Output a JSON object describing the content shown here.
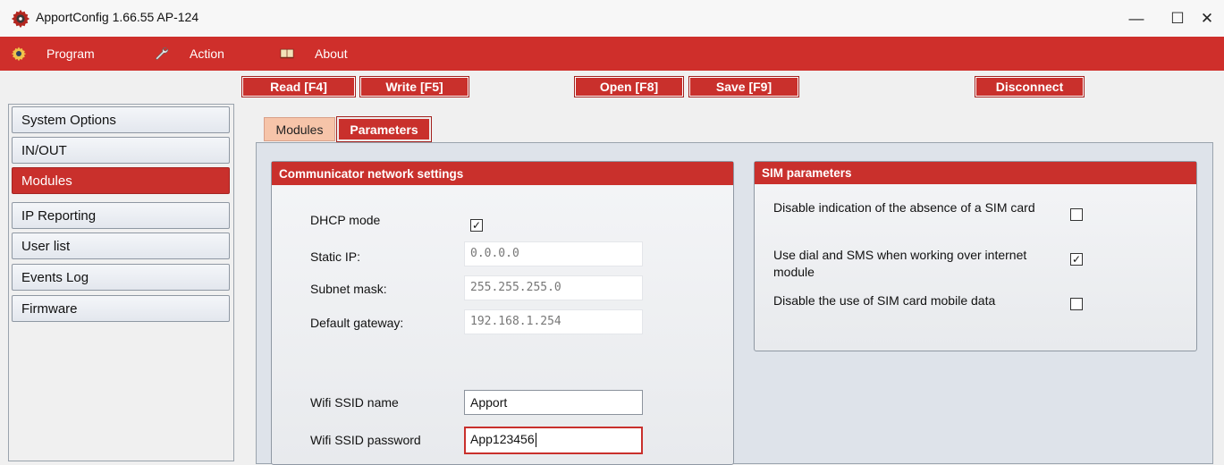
{
  "window": {
    "title": "ApportConfig 1.66.55   AP-124",
    "controls": {
      "minimize": "—",
      "maximize": "☐",
      "close": "✕"
    }
  },
  "menu": {
    "items": [
      {
        "label": "Program",
        "icon": "gear-icon"
      },
      {
        "label": "Action",
        "icon": "wrench-icon"
      },
      {
        "label": "About",
        "icon": "book-icon"
      }
    ]
  },
  "toolbar": {
    "read": "Read [F4]",
    "write": "Write [F5]",
    "open": "Open [F8]",
    "save": "Save [F9]",
    "disconnect": "Disconnect"
  },
  "sidebar": {
    "items": [
      {
        "label": "System Options"
      },
      {
        "label": "IN/OUT"
      },
      {
        "label": "Modules",
        "active": true
      },
      {
        "label": "IP Reporting"
      },
      {
        "label": "User list"
      },
      {
        "label": "Events Log"
      },
      {
        "label": "Firmware"
      }
    ]
  },
  "tabs": {
    "modules": "Modules",
    "parameters": "Parameters",
    "active": "Parameters"
  },
  "network": {
    "header": "Communicator network settings",
    "dhcp_label": "DHCP mode",
    "dhcp_checked": true,
    "static_ip_label": "Static IP:",
    "static_ip": "0.0.0.0",
    "subnet_label": "Subnet mask:",
    "subnet": "255.255.255.0",
    "gateway_label": "Default gateway:",
    "gateway": "192.168.1.254",
    "ssid_label": "Wifi SSID name",
    "ssid": "Apport",
    "password_label": "Wifi SSID password",
    "password": "App123456"
  },
  "sim": {
    "header": "SIM parameters",
    "options": [
      {
        "label": "Disable indication of the absence of a SIM card",
        "checked": false
      },
      {
        "label": "Use dial and SMS when working over internet module",
        "checked": true
      },
      {
        "label": "Disable the use of SIM card mobile data",
        "checked": false
      }
    ]
  },
  "colors": {
    "accent": "#cf2f2b",
    "tab_inactive": "#f6c4a9",
    "panel": "#dee3ea"
  },
  "check_glyph": "✓"
}
